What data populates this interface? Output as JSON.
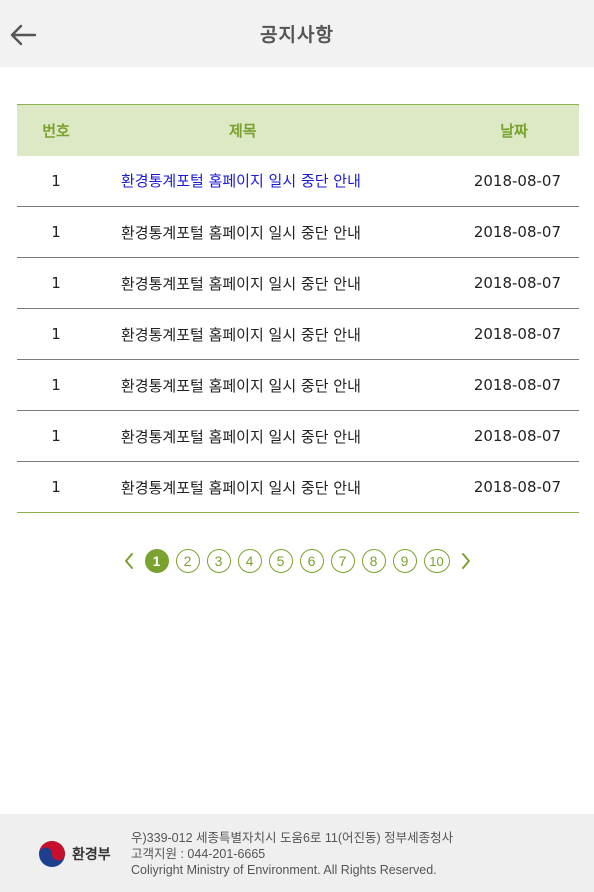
{
  "header": {
    "title": "공지사항",
    "back_icon": "arrow-left-icon"
  },
  "table": {
    "columns": [
      "번호",
      "제목",
      "날짜"
    ],
    "rows": [
      {
        "num": "1",
        "title": "환경통계포털 홈페이지 일시 중단 안내",
        "date": "2018-08-07",
        "active": true
      },
      {
        "num": "1",
        "title": "환경통계포털 홈페이지 일시 중단 안내",
        "date": "2018-08-07",
        "active": false
      },
      {
        "num": "1",
        "title": "환경통계포털 홈페이지 일시 중단 안내",
        "date": "2018-08-07",
        "active": false
      },
      {
        "num": "1",
        "title": "환경통계포털 홈페이지 일시 중단 안내",
        "date": "2018-08-07",
        "active": false
      },
      {
        "num": "1",
        "title": "환경통계포털 홈페이지 일시 중단 안내",
        "date": "2018-08-07",
        "active": false
      },
      {
        "num": "1",
        "title": "환경통계포털 홈페이지 일시 중단 안내",
        "date": "2018-08-07",
        "active": false
      },
      {
        "num": "1",
        "title": "환경통계포털 홈페이지 일시 중단 안내",
        "date": "2018-08-07",
        "active": false
      }
    ]
  },
  "pagination": {
    "pages": [
      "1",
      "2",
      "3",
      "4",
      "5",
      "6",
      "7",
      "8",
      "9",
      "10"
    ],
    "current": "1",
    "prev_icon": "chevron-left-icon",
    "next_icon": "chevron-right-icon"
  },
  "footer": {
    "logo_text": "환경부",
    "address": "우)339-012 세종특별자치시 도움6로 11(어진동) 정부세종청사",
    "phone": "고객지원 : 044-201-6665",
    "copyright": "Coliyright Ministry of Environment. All Rights Reserved."
  },
  "colors": {
    "accent": "#7aa22e",
    "header_bg": "#dce9c4",
    "active_link": "#1a1ad8"
  }
}
